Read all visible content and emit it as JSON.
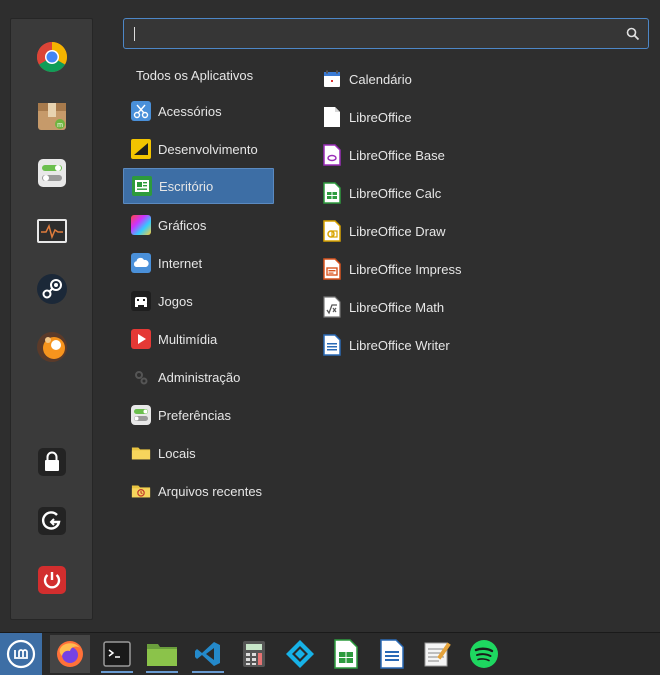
{
  "search": {
    "value": "",
    "placeholder": ""
  },
  "favorites": [
    {
      "name": "chrome-icon",
      "label": "Google Chrome"
    },
    {
      "name": "package-icon",
      "label": "Package"
    },
    {
      "name": "settings-toggle-icon",
      "label": "Settings"
    },
    {
      "name": "system-monitor-icon",
      "label": "System Monitor"
    },
    {
      "name": "steam-icon",
      "label": "Steam"
    },
    {
      "name": "app-orange-icon",
      "label": "App"
    },
    {
      "name": "lock-icon",
      "label": "Lock"
    },
    {
      "name": "logout-icon",
      "label": "Logout"
    },
    {
      "name": "power-icon",
      "label": "Power"
    }
  ],
  "categories": {
    "all": "Todos os Aplicativos",
    "items": [
      {
        "label": "Acessórios",
        "icon": "scissors-icon"
      },
      {
        "label": "Desenvolvimento",
        "icon": "development-icon"
      },
      {
        "label": "Escritório",
        "icon": "office-icon",
        "active": true
      },
      {
        "label": "Gráficos",
        "icon": "graphics-icon"
      },
      {
        "label": "Internet",
        "icon": "cloud-icon"
      },
      {
        "label": "Jogos",
        "icon": "gamepad-icon"
      },
      {
        "label": "Multimídia",
        "icon": "play-icon"
      },
      {
        "label": "Administração",
        "icon": "gears-icon"
      },
      {
        "label": "Preferências",
        "icon": "preferences-icon"
      },
      {
        "label": "Locais",
        "icon": "folder-icon"
      },
      {
        "label": "Arquivos recentes",
        "icon": "recent-folder-icon"
      }
    ]
  },
  "apps": [
    {
      "label": "Calendário",
      "icon": "calendar-icon"
    },
    {
      "label": "LibreOffice",
      "icon": "libreoffice-icon"
    },
    {
      "label": "LibreOffice Base",
      "icon": "libreoffice-base-icon",
      "color": "#9a2db8"
    },
    {
      "label": "LibreOffice Calc",
      "icon": "libreoffice-calc-icon",
      "color": "#2e9c3f"
    },
    {
      "label": "LibreOffice Draw",
      "icon": "libreoffice-draw-icon",
      "color": "#d8a400"
    },
    {
      "label": "LibreOffice Impress",
      "icon": "libreoffice-impress-icon",
      "color": "#d8541e"
    },
    {
      "label": "LibreOffice Math",
      "icon": "libreoffice-math-icon",
      "color": "#777777"
    },
    {
      "label": "LibreOffice Writer",
      "icon": "libreoffice-writer-icon",
      "color": "#2a6ab6"
    }
  ],
  "taskbar": [
    {
      "name": "mint-menu-icon"
    },
    {
      "name": "firefox-icon"
    },
    {
      "name": "terminal-icon"
    },
    {
      "name": "files-icon"
    },
    {
      "name": "vscode-icon"
    },
    {
      "name": "calculator-icon"
    },
    {
      "name": "kodi-icon"
    },
    {
      "name": "libreoffice-calc-icon"
    },
    {
      "name": "libreoffice-writer-icon"
    },
    {
      "name": "text-editor-icon"
    },
    {
      "name": "spotify-icon"
    }
  ],
  "colors": {
    "accent": "#3d6ea5",
    "panel": "#2e2e2e",
    "sidebar": "#3a3a3a"
  }
}
